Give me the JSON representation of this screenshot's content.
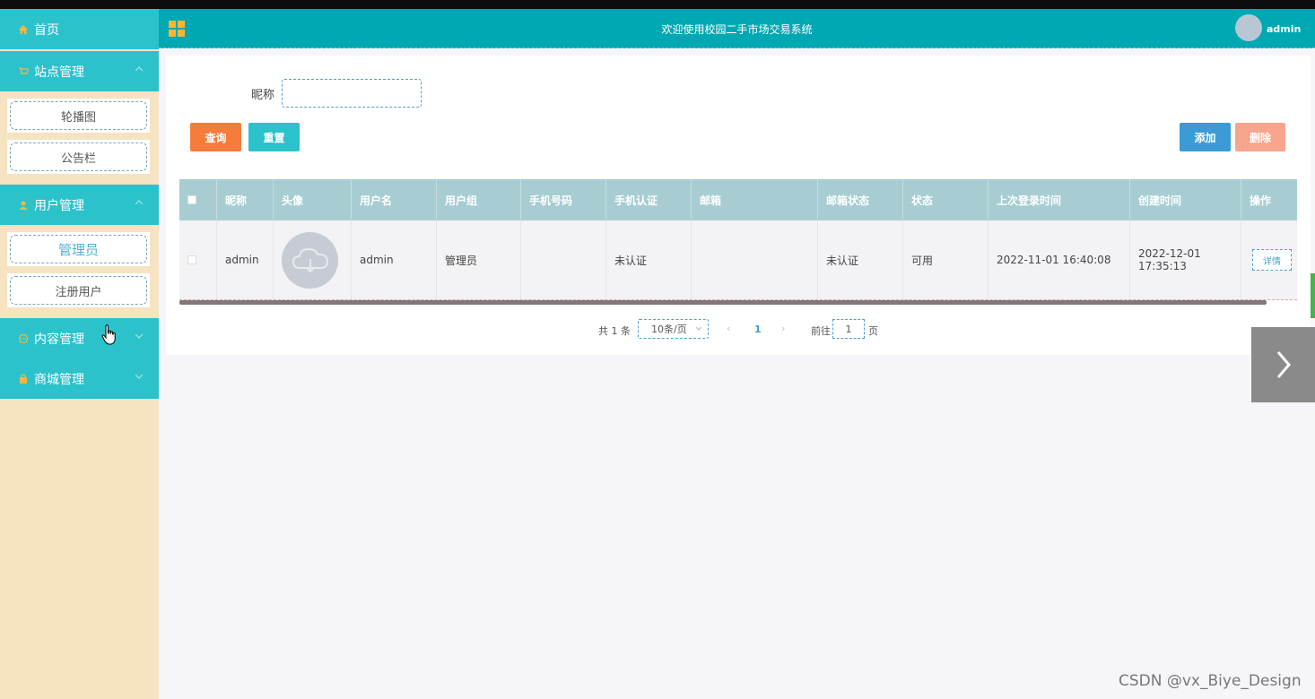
{
  "sidebar": {
    "home": "首页",
    "groups": [
      {
        "label": "站点管理",
        "items": [
          "轮播图",
          "公告栏"
        ]
      },
      {
        "label": "用户管理",
        "items": [
          "管理员",
          "注册用户"
        ]
      },
      {
        "label": "内容管理",
        "items": []
      },
      {
        "label": "商城管理",
        "items": []
      }
    ],
    "active_item": "管理员"
  },
  "header": {
    "title": "欢迎使用校园二手市场交易系统",
    "username": "admin"
  },
  "search": {
    "nickname_label": "昵称",
    "nickname_value": "",
    "query_label": "查询",
    "reset_label": "重置",
    "add_label": "添加",
    "delete_label": "删除"
  },
  "table": {
    "columns": [
      "昵称",
      "头像",
      "用户名",
      "用户组",
      "手机号码",
      "手机认证",
      "邮箱",
      "邮箱状态",
      "状态",
      "上次登录时间",
      "创建时间",
      "操作"
    ],
    "rows": [
      {
        "nickname": "admin",
        "username": "admin",
        "group": "管理员",
        "phone": "",
        "phone_verified": "未认证",
        "email": "",
        "email_status": "未认证",
        "status": "可用",
        "last_login": "2022-11-01 16:40:08",
        "created": "2022-12-01 17:35:13",
        "action": "详情"
      }
    ]
  },
  "pager": {
    "total": "共 1 条",
    "page_size": "10条/页",
    "prev": "‹",
    "current_page": "1",
    "next": "›",
    "goto_label": "前往",
    "goto_value": "1",
    "page_suffix": "页"
  },
  "watermark": "CSDN @vx_Biye_Design",
  "colors": {
    "sidebar_head": "#2cc2cc",
    "sidebar_bg": "#f6e3c2",
    "header_bg": "#00a8b3",
    "query_btn": "#f57c3b",
    "add_btn": "#3a9bd5",
    "delete_btn": "#f9a48d"
  }
}
